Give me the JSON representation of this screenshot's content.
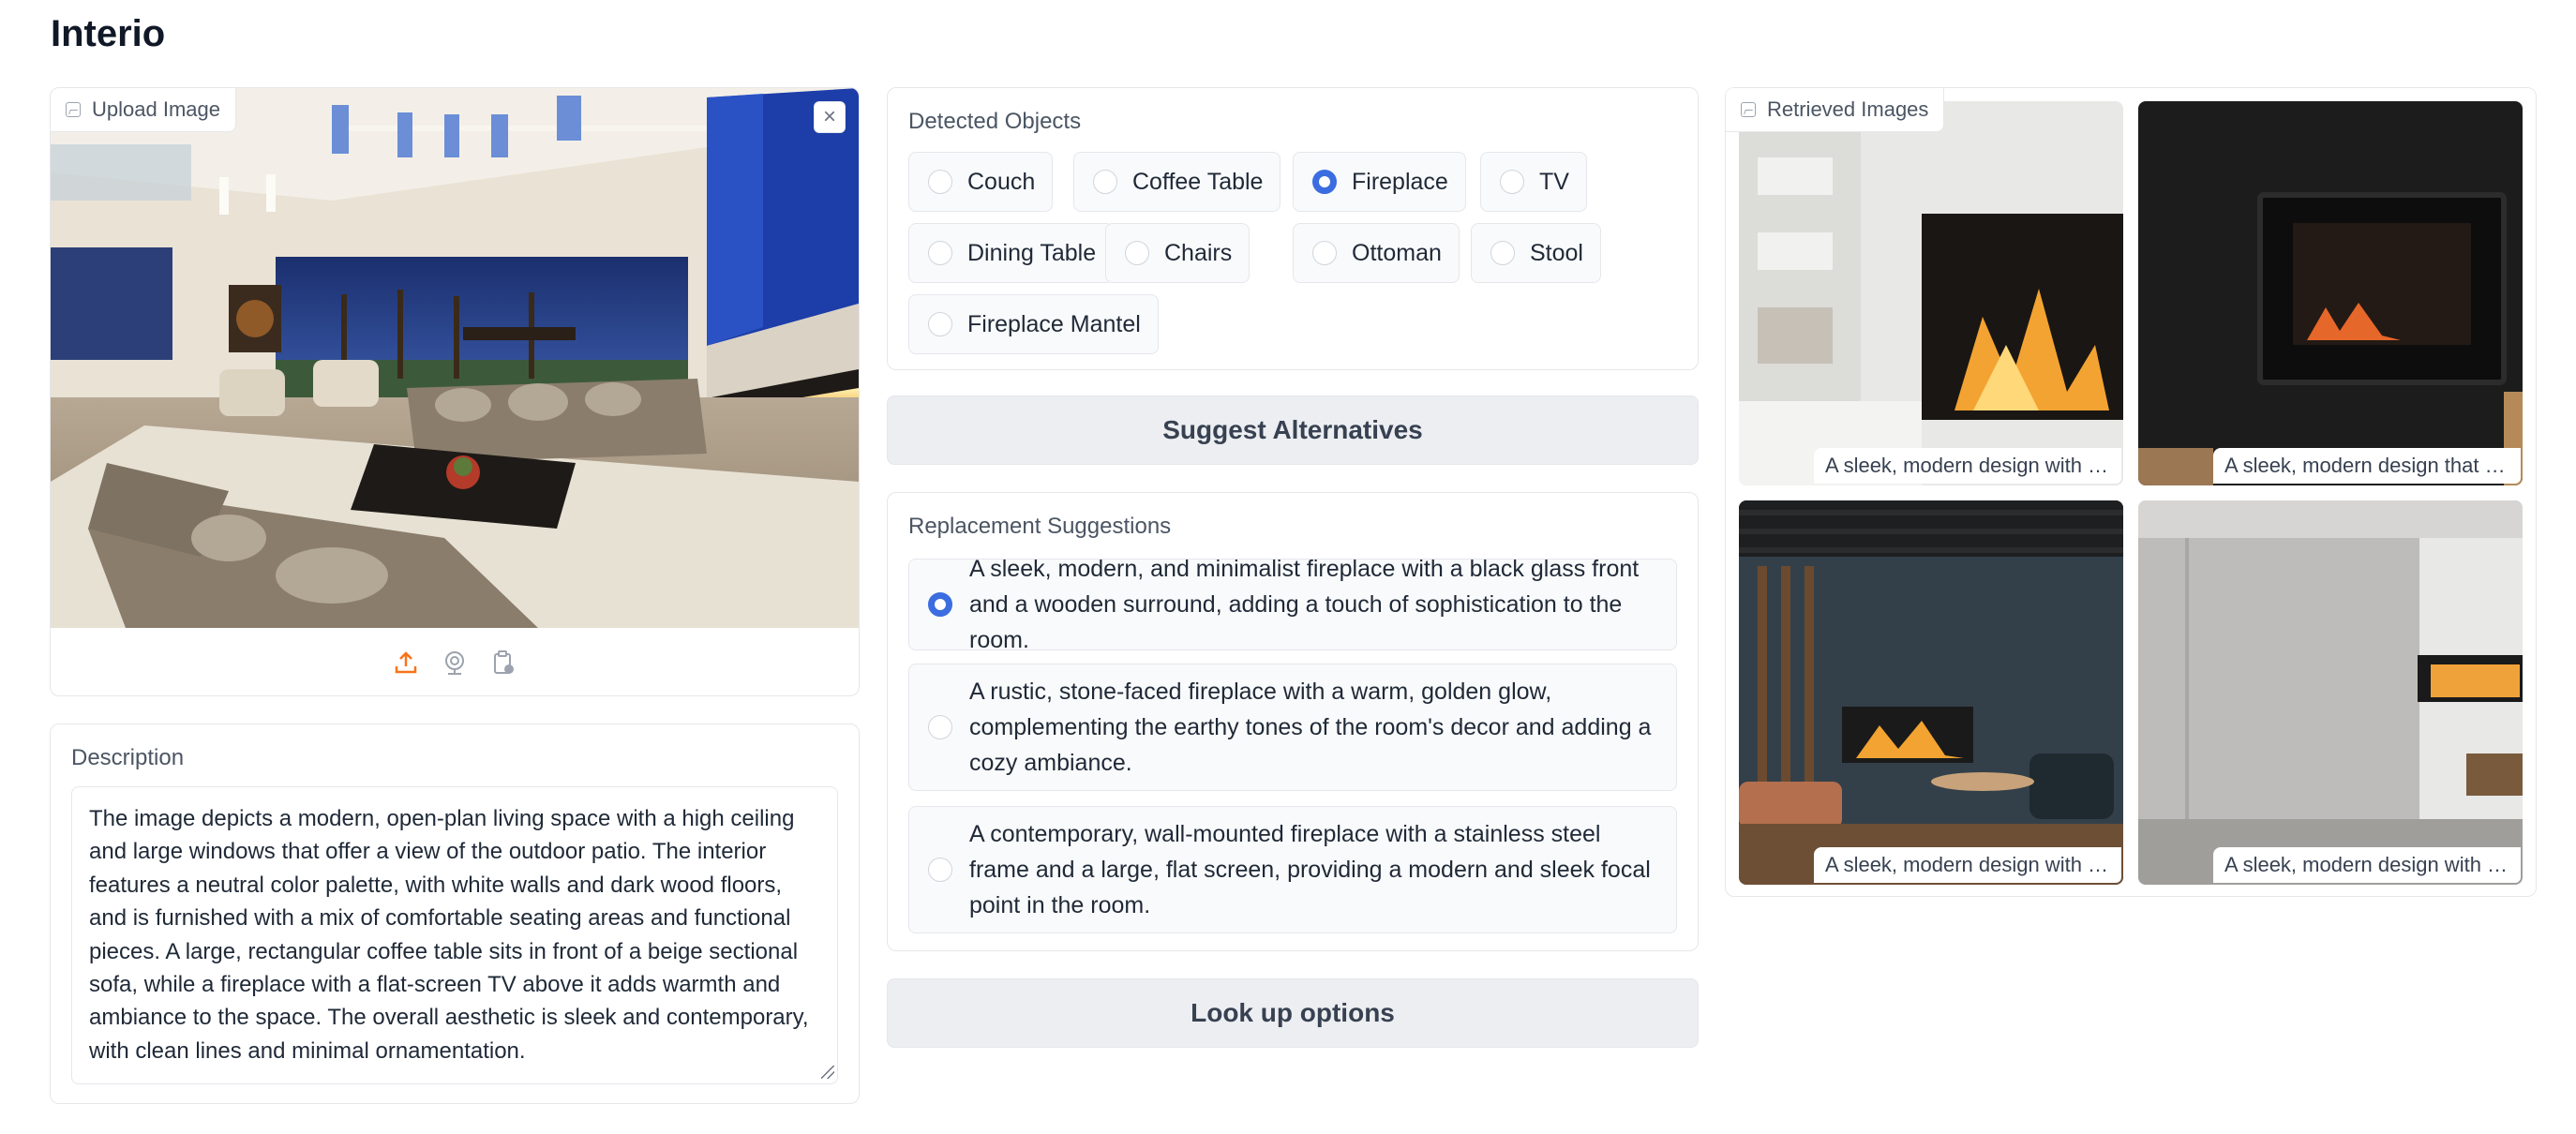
{
  "app": {
    "title": "Interio"
  },
  "upload": {
    "label": "Upload Image",
    "close_symbol": "×",
    "tools": [
      "upload-icon",
      "webcam-icon",
      "clipboard-icon"
    ],
    "accent_color": "#f97316"
  },
  "description": {
    "label": "Description",
    "text": "The image depicts a modern, open-plan living space with a high ceiling and large windows that offer a view of the outdoor patio. The interior features a neutral color palette, with white walls and dark wood floors, and is furnished with a mix of comfortable seating areas and functional pieces. A large, rectangular coffee table sits in front of a beige sectional sofa, while a fireplace with a flat-screen TV above it adds warmth and ambiance to the space. The overall aesthetic is sleek and contemporary, with clean lines and minimal ornamentation."
  },
  "detected": {
    "label": "Detected Objects",
    "options": [
      "Couch",
      "Coffee Table",
      "Fireplace",
      "TV",
      "Dining Table",
      "Chairs",
      "Ottoman",
      "Stool",
      "Fireplace Mantel"
    ],
    "selected": "Fireplace"
  },
  "buttons": {
    "suggest": "Suggest Alternatives",
    "lookup": "Look up options"
  },
  "replacement": {
    "label": "Replacement Suggestions",
    "options": [
      "A sleek, modern, and minimalist fireplace with a black glass front and a wooden surround, adding a touch of sophistication to the room.",
      "A rustic, stone-faced fireplace with a warm, golden glow, complementing the earthy tones of the room's decor and adding a cozy ambiance.",
      "A contemporary, wall-mounted fireplace with a stainless steel frame and a large, flat screen, providing a modern and sleek focal point in the room."
    ],
    "selected_index": 0
  },
  "retrieved": {
    "label": "Retrieved Images",
    "captions": [
      "A sleek, modern design with a …",
      "A sleek, modern design that se…",
      "A sleek, modern design with a …",
      "A sleek, modern design with a …"
    ]
  },
  "colors": {
    "accent": "#3b6de0",
    "border": "#e5e7eb",
    "button_bg": "#eceef1"
  }
}
